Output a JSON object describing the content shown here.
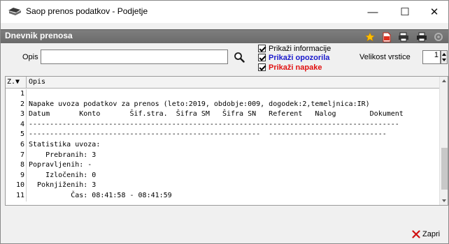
{
  "window": {
    "title": "Saop prenos podatkov - Podjetje",
    "minimize": "—",
    "maximize": "☐",
    "close": "✕"
  },
  "header": {
    "title": "Dnevnik prenosa",
    "icons": [
      "star-icon",
      "pdf-icon",
      "print-multiple-icon",
      "printer-icon",
      "settings-disabled-icon"
    ]
  },
  "filter": {
    "opis_label": "Opis",
    "opis_value": "",
    "show_info_label": "Prikaži informacije",
    "show_warnings_label": "Prikaži opozorila",
    "show_errors_label": "Prikaži napake",
    "row_size_label": "Velikost vrstice",
    "row_size_value": "1"
  },
  "grid": {
    "col_num": "Z.▼",
    "col_opis": "Opis",
    "rows": [
      {
        "n": "1",
        "t": ""
      },
      {
        "n": "2",
        "t": "Napake uvoza podatkov za prenos (leto:2019, obdobje:009, dogodek:2,temeljnica:IR)"
      },
      {
        "n": "3",
        "t": "Datum       Konto       Šif.stra.  Šifra SM   Šifra SN   Referent   Nalog        Dokument"
      },
      {
        "n": "4",
        "t": "----------------------------------------------------------------------------------------"
      },
      {
        "n": "5",
        "t": "-------------------------------------------------------  ----------------------------"
      },
      {
        "n": "6",
        "t": "Statistika uvoza:"
      },
      {
        "n": "7",
        "t": "    Prebranih: 3"
      },
      {
        "n": "8",
        "t": "Popravljenih: -"
      },
      {
        "n": "9",
        "t": "    Izločenih: 0"
      },
      {
        "n": "10",
        "t": "  Poknjiženih: 3"
      },
      {
        "n": "11",
        "t": "          Čas: 08:41:58 - 08:41:59"
      }
    ]
  },
  "footer": {
    "close_label": "Zapri"
  },
  "colors": {
    "warnings": "#1a1acc",
    "errors": "#e01010",
    "header_band": "#727272"
  }
}
